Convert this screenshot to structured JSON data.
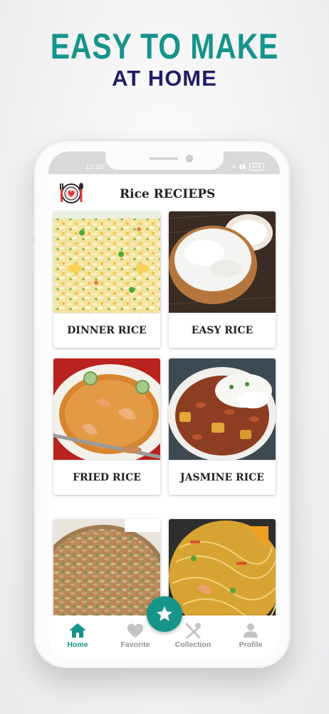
{
  "promo": {
    "headline_line1": "EASY TO MAKE",
    "headline_line2": "AT HOME"
  },
  "status_bar": {
    "time": "12:10",
    "battery": "100"
  },
  "app": {
    "title": "Rice RECIEPS",
    "logo_icon": "plate-heart-fork-spoon-icon"
  },
  "recipes": [
    {
      "label": "DINNER RICE"
    },
    {
      "label": "EASY RICE"
    },
    {
      "label": "FRIED RICE"
    },
    {
      "label": "JASMINE RICE"
    },
    {
      "label": ""
    },
    {
      "label": ""
    }
  ],
  "fab": {
    "icon": "star-icon"
  },
  "bottom_nav": {
    "items": [
      {
        "label": "Home",
        "icon": "home-icon",
        "active": true
      },
      {
        "label": "Favorite",
        "icon": "heart-icon",
        "active": false
      },
      {
        "label": "Collection",
        "icon": "fork-spoon-icon",
        "active": false
      },
      {
        "label": "Profile",
        "icon": "person-icon",
        "active": false
      }
    ]
  },
  "colors": {
    "accent": "#16948a",
    "headline_secondary": "#1f1e66",
    "inactive": "#8f8f8f"
  }
}
